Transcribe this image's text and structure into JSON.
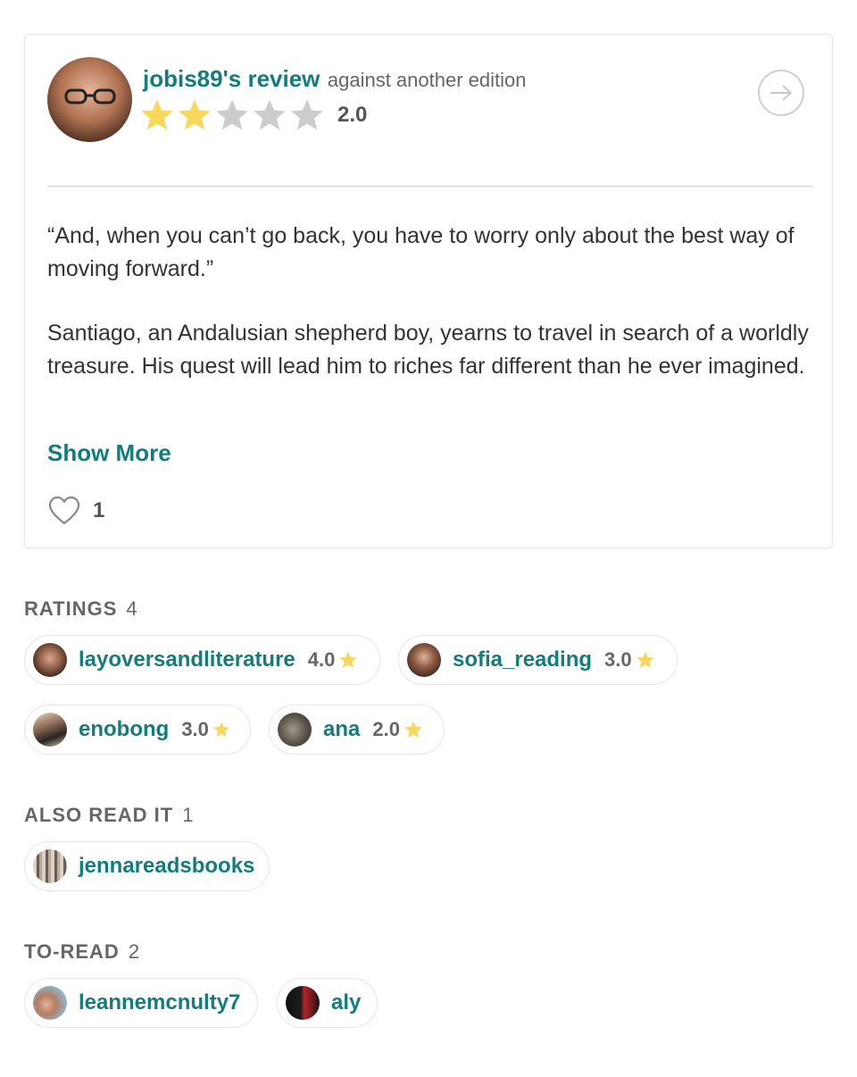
{
  "review": {
    "username": "jobis89's review",
    "edition_note": "against another edition",
    "rating": "2.0",
    "stars_filled": 2,
    "stars_total": 5,
    "paragraphs": [
      "“And, when you can’t go back, you have to worry only about the best way of moving forward.”",
      "Santiago, an Andalusian shepherd boy, yearns to travel in search of a worldly treasure. His quest will lead him to riches far different than he ever imagined."
    ],
    "show_more": "Show More",
    "likes": "1"
  },
  "ratings": {
    "title": "RATINGS",
    "count": "4",
    "items": [
      {
        "user": "layoversandliterature",
        "rating": "4.0"
      },
      {
        "user": "sofia_reading",
        "rating": "3.0"
      },
      {
        "user": "enobong",
        "rating": "3.0"
      },
      {
        "user": "ana",
        "rating": "2.0"
      }
    ]
  },
  "also_read": {
    "title": "ALSO READ IT",
    "count": "1",
    "items": [
      {
        "user": "jennareadsbooks"
      }
    ]
  },
  "to_read": {
    "title": "TO-READ",
    "count": "2",
    "items": [
      {
        "user": "leannemcnulty7"
      },
      {
        "user": "aly"
      }
    ]
  },
  "colors": {
    "accent": "#127d7c",
    "star_filled": "#f7d75c",
    "star_empty": "#cccccc"
  }
}
